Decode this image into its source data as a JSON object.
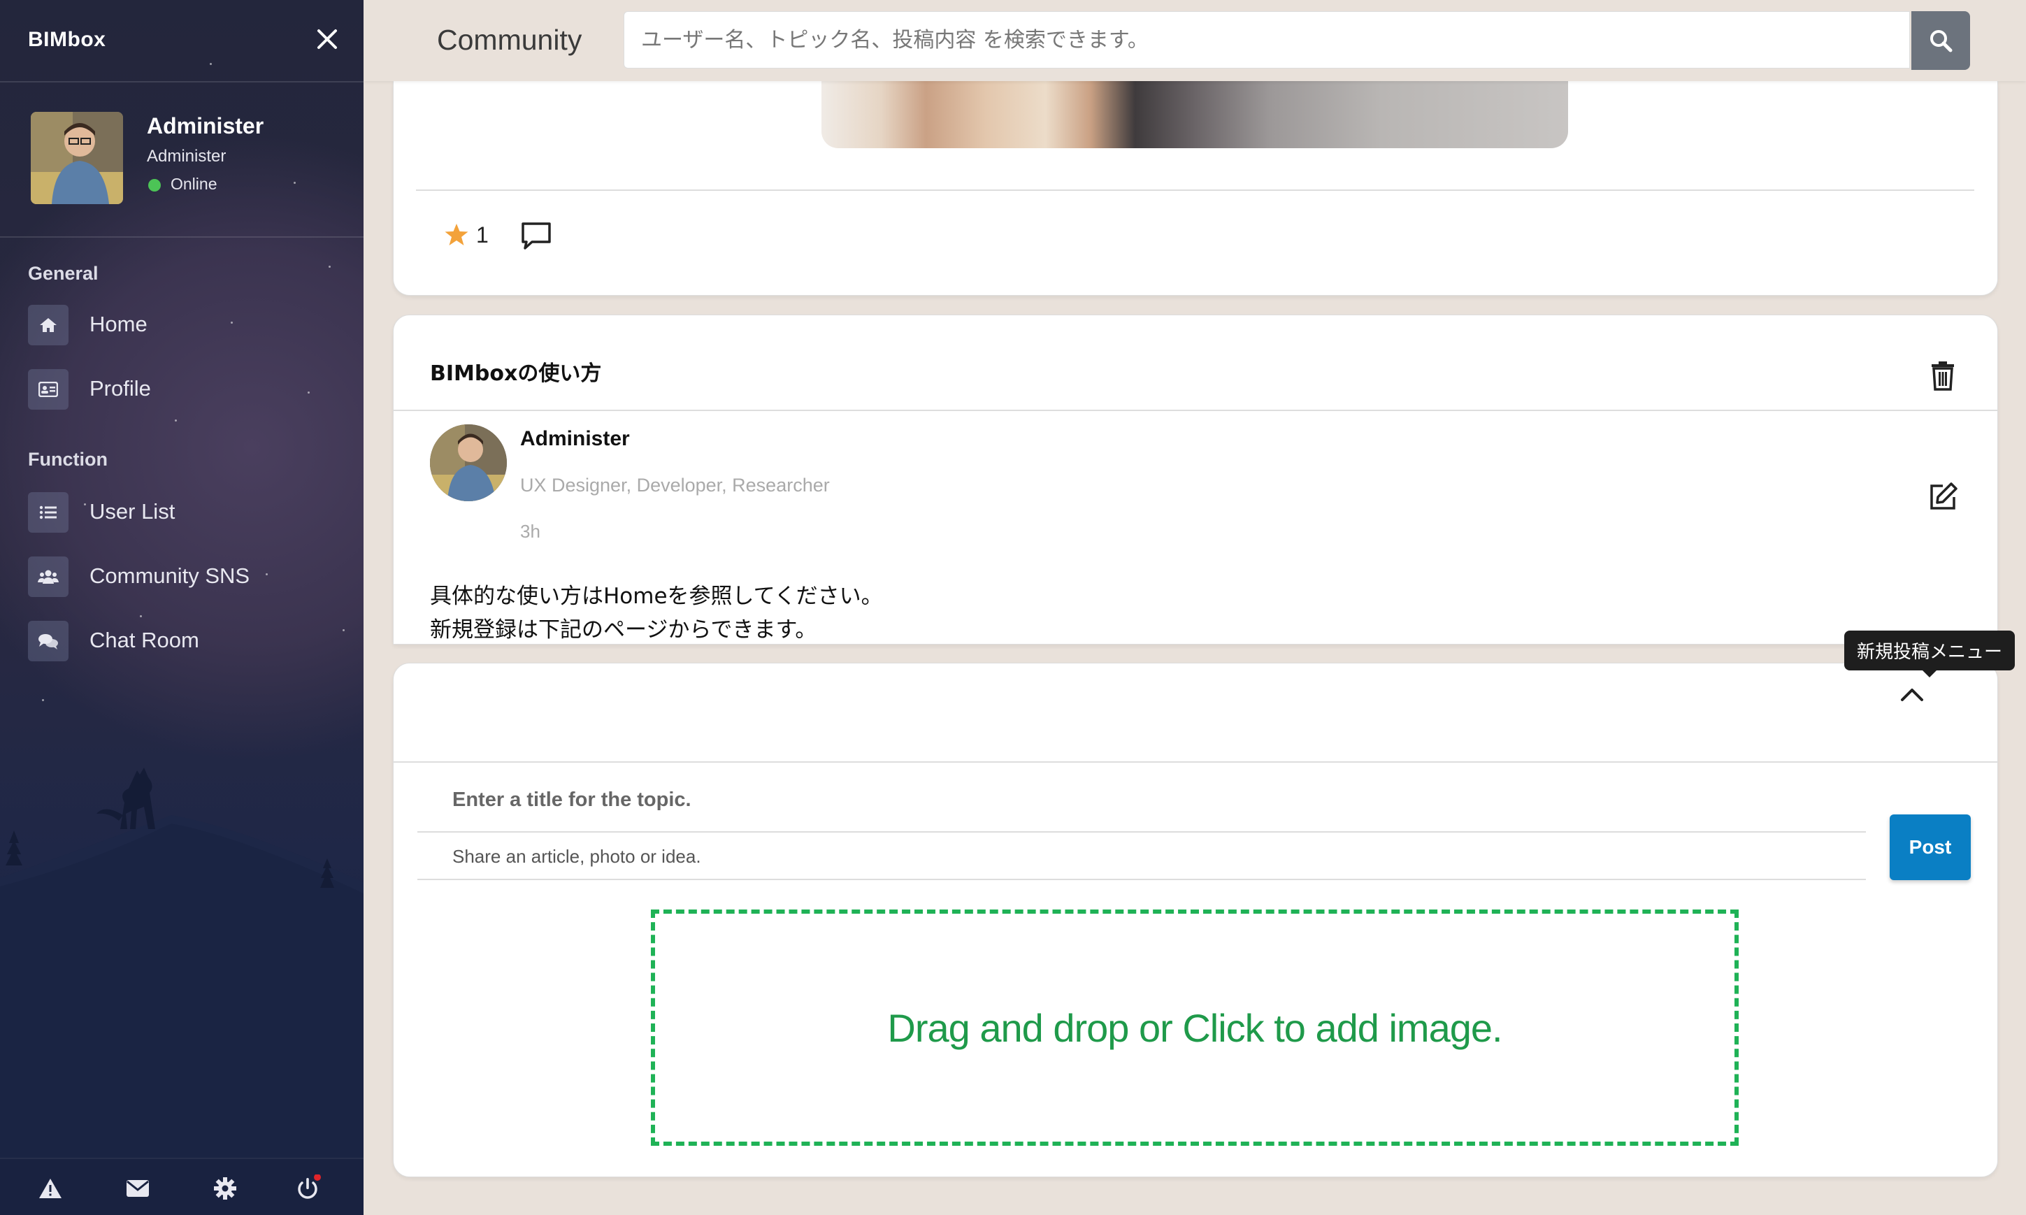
{
  "sidebar": {
    "brand": "BIMbox",
    "user": {
      "name": "Administer",
      "role": "Administer",
      "status": "Online"
    },
    "sections": [
      {
        "title": "General",
        "items": [
          {
            "label": "Home",
            "icon": "home-icon"
          },
          {
            "label": "Profile",
            "icon": "id-card-icon"
          }
        ]
      },
      {
        "title": "Function",
        "items": [
          {
            "label": "User List",
            "icon": "list-icon"
          },
          {
            "label": "Community SNS",
            "icon": "users-icon"
          },
          {
            "label": "Chat Room",
            "icon": "chat-bubbles-icon"
          }
        ]
      }
    ],
    "bottom_icons": [
      "warning-icon",
      "mail-icon",
      "gear-icon",
      "power-icon"
    ]
  },
  "header": {
    "title": "Community",
    "search_placeholder": "ユーザー名、トピック名、投稿内容 を検索できます。"
  },
  "feed": {
    "first_post": {
      "like_count": "1"
    },
    "second_post": {
      "title": "BIMboxの使い方",
      "author": "Administer",
      "roles": "UX Designer, Developer, Researcher",
      "time": "3h",
      "body_lines": [
        "具体的な使い方はHomeを参照してください。",
        "新規登録は下記のページからできます。"
      ]
    }
  },
  "composer": {
    "tooltip": "新規投稿メニュー",
    "title_placeholder": "Enter a title for the topic.",
    "body_placeholder": "Share an article, photo or idea.",
    "post_label": "Post",
    "dropzone_text": "Drag and drop or Click to add image."
  },
  "colors": {
    "accent_blue": "#0a7fc4",
    "dropzone_green": "#1fb256",
    "online_green": "#4cc456",
    "star": "#f3a23a"
  }
}
